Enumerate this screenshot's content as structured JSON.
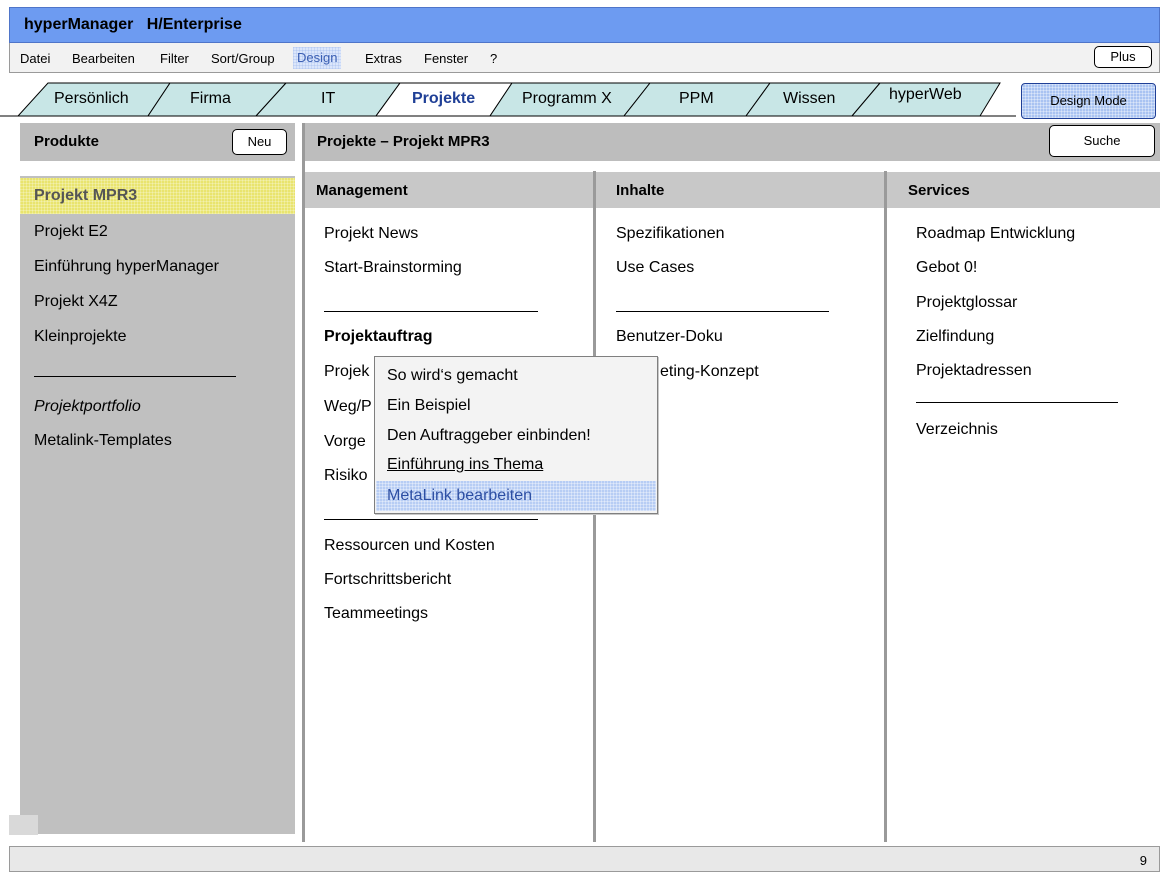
{
  "app": {
    "title": "hyperManager   H/Enterprise"
  },
  "menu": {
    "items": [
      "Datei",
      "Bearbeiten",
      "Filter",
      "Sort/Group",
      "Design",
      "Extras",
      "Fenster",
      "?"
    ],
    "plus_label": "Plus"
  },
  "tabs": {
    "items": [
      "Persönlich",
      "Firma",
      "IT",
      "Projekte",
      "Programm X",
      "PPM",
      "Wissen",
      "hyperWeb"
    ],
    "active": "Projekte",
    "design_mode_label": "Design Mode"
  },
  "sidebar": {
    "title": "Produkte",
    "new_label": "Neu",
    "items": [
      "Projekt MPR3",
      "Projekt E2",
      "Einführung hyperManager",
      "Projekt X4Z",
      "Kleinprojekte"
    ],
    "selected": "Projekt MPR3",
    "portfolio_label": "Projektportfolio",
    "templates_label": "Metalink-Templates"
  },
  "main": {
    "title": "Projekte – Projekt MPR3",
    "search_label": "Suche",
    "columns": {
      "management": {
        "title": "Management",
        "group1": [
          "Projekt News",
          "Start-Brainstorming"
        ],
        "section_title": "Projektauftrag",
        "group2": [
          "Projek",
          "Weg/P",
          "Vorge",
          "Risiko"
        ],
        "group3": [
          "Ressourcen und Kosten",
          "Fortschrittsbericht",
          "Teammeetings"
        ]
      },
      "inhalte": {
        "title": "Inhalte",
        "group1": [
          "Spezifikationen",
          "Use Cases"
        ],
        "group2": [
          "Benutzer-Doku",
          "eting-Konzept"
        ]
      },
      "services": {
        "title": "Services",
        "group1": [
          "Roadmap Entwicklung",
          "Gebot 0!",
          "Projektglossar",
          "Zielfindung",
          "Projektadressen"
        ],
        "group2": [
          "Verzeichnis"
        ]
      }
    }
  },
  "context_menu": {
    "items": [
      "So wird‘s gemacht",
      "Ein Beispiel",
      "Den Auftraggeber einbinden!",
      "Einführung ins Thema",
      "MetaLink bearbeiten"
    ],
    "highlighted": "MetaLink bearbeiten"
  },
  "status": {
    "page_number": "9"
  },
  "colors": {
    "title_bar": "#6d9bf1",
    "tab_fill": "#c8e6e6",
    "active_tab_text": "#1f3f96",
    "selection_yellow": "#e9e46e",
    "highlight_blue": "#b7cdf4",
    "panel_gray": "#c0c0c0"
  }
}
